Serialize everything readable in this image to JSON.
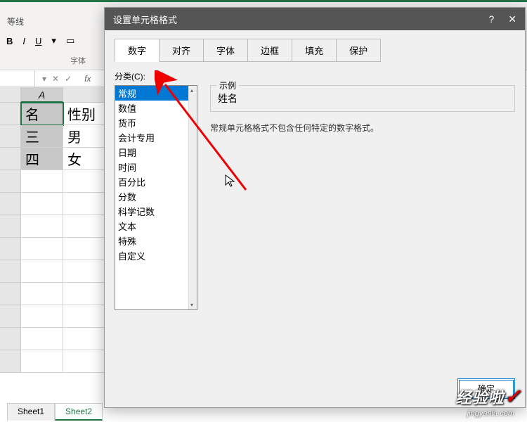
{
  "ribbon": {
    "section_label": "等线",
    "group_label": "字体",
    "bold": "B",
    "italic": "I",
    "underline": "U"
  },
  "formula_bar": {
    "fx": "fx",
    "cancel": "✕",
    "confirm": "✓",
    "dropdown": "▾"
  },
  "grid": {
    "col_a": "A",
    "cells": {
      "a1_partial": "名",
      "b1": "性别",
      "a2_partial": "三",
      "b2": "男",
      "a3_partial": "四",
      "b3": "女"
    }
  },
  "sheets": {
    "tab1": "Sheet1",
    "tab2": "Sheet2"
  },
  "dialog": {
    "title": "设置单元格格式",
    "help": "?",
    "close": "✕",
    "tabs": {
      "number": "数字",
      "alignment": "对齐",
      "font": "字体",
      "border": "边框",
      "fill": "填充",
      "protection": "保护"
    },
    "category_label": "分类(C):",
    "categories": {
      "general": "常规",
      "number": "数值",
      "currency": "货币",
      "accounting": "会计专用",
      "date": "日期",
      "time": "时间",
      "percentage": "百分比",
      "fraction": "分数",
      "scientific": "科学记数",
      "text": "文本",
      "special": "特殊",
      "custom": "自定义"
    },
    "example_label": "示例",
    "example_value": "姓名",
    "description": "常规单元格格式不包含任何特定的数字格式。",
    "ok_button": "确定"
  },
  "watermark": {
    "main": "经验啦",
    "sub": "jingyanla.com"
  }
}
